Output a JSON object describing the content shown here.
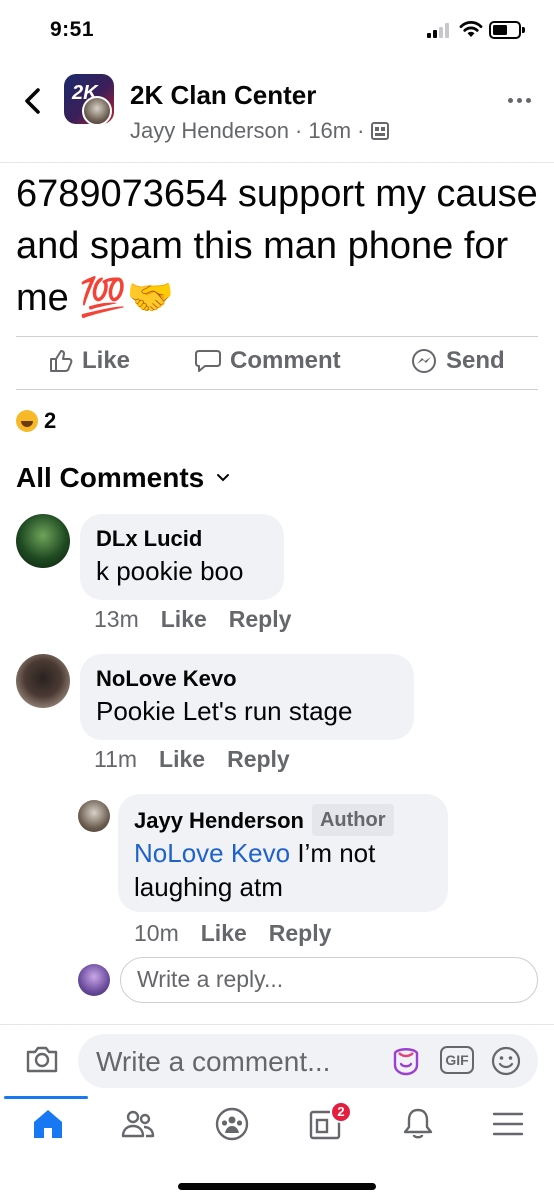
{
  "status_bar": {
    "time": "9:51"
  },
  "header": {
    "group_name": "2K Clan Center",
    "author": "Jayy Henderson",
    "separator": "·",
    "time": "16m",
    "group_avatar_text": "2K"
  },
  "post": {
    "text": "6789073654 support my cause and spam this man phone for me 💯🤝",
    "actions": {
      "like": "Like",
      "comment": "Comment",
      "send": "Send"
    },
    "reaction_count": "2"
  },
  "comments_header": "All Comments",
  "comments": [
    {
      "name": "DLx Lucid",
      "text": "k pookie boo",
      "time": "13m",
      "like": "Like",
      "reply": "Reply"
    },
    {
      "name": "NoLove Kevo",
      "text": "Pookie Let's run stage",
      "time": "11m",
      "like": "Like",
      "reply": "Reply"
    }
  ],
  "reply": {
    "name": "Jayy Henderson",
    "author_tag": "Author",
    "mention": "NoLove Kevo",
    "text_line1": " I’m not",
    "text_line2": "laughing atm",
    "time": "10m",
    "like": "Like",
    "reply": "Reply"
  },
  "reply_input_placeholder": "Write a reply...",
  "composer": {
    "placeholder": "Write a comment...",
    "gif_label": "GIF"
  },
  "tabbar": {
    "notifications_badge": "2"
  },
  "colors": {
    "accent": "#1877f2",
    "mention": "#1f62c9",
    "badge": "#e41e3f",
    "bubble": "#f0f2f5",
    "secondary_text": "#65676b"
  },
  "icons": [
    "back-chevron-icon",
    "more-dots-icon",
    "like-thumb-icon",
    "comment-icon",
    "messenger-icon",
    "haha-reaction-icon",
    "chevron-down-icon",
    "camera-icon",
    "avatar-sticker-icon",
    "gif-icon",
    "emoji-icon",
    "home-icon",
    "friends-icon",
    "groups-icon",
    "pages-icon",
    "bell-icon",
    "menu-icon"
  ]
}
